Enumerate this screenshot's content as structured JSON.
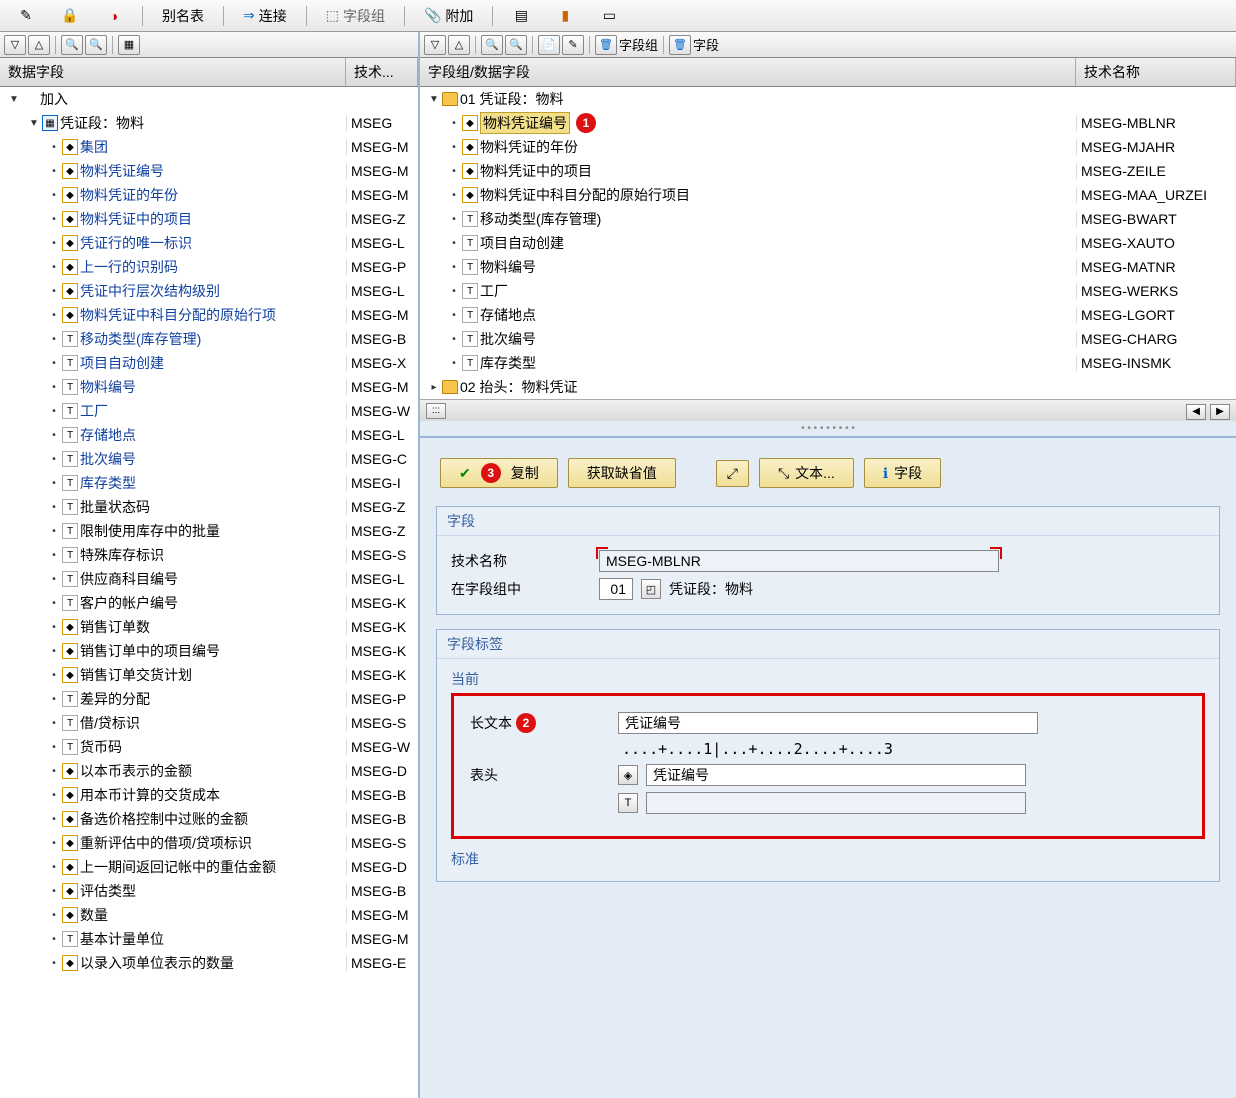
{
  "topbar": {
    "alias_table": "别名表",
    "connect": "连接",
    "field_group": "字段组",
    "attach": "附加"
  },
  "left": {
    "col1": "数据字段",
    "col2": "技术...",
    "rows": [
      {
        "indent": 0,
        "exp": "▼",
        "icon": "",
        "lbl": "加入",
        "tech": "",
        "link": false
      },
      {
        "indent": 1,
        "exp": "▼",
        "icon": "table",
        "lbl": "凭证段：物料",
        "tech": "MSEG",
        "link": false
      },
      {
        "indent": 2,
        "exp": "•",
        "icon": "key",
        "lbl": "集团",
        "tech": "MSEG-M",
        "link": true
      },
      {
        "indent": 2,
        "exp": "•",
        "icon": "key",
        "lbl": "物料凭证编号",
        "tech": "MSEG-M",
        "link": true
      },
      {
        "indent": 2,
        "exp": "•",
        "icon": "key",
        "lbl": "物料凭证的年份",
        "tech": "MSEG-M",
        "link": true
      },
      {
        "indent": 2,
        "exp": "•",
        "icon": "key",
        "lbl": "物料凭证中的项目",
        "tech": "MSEG-Z",
        "link": true
      },
      {
        "indent": 2,
        "exp": "•",
        "icon": "key",
        "lbl": "凭证行的唯一标识",
        "tech": "MSEG-L",
        "link": true
      },
      {
        "indent": 2,
        "exp": "•",
        "icon": "key",
        "lbl": "上一行的识别码",
        "tech": "MSEG-P",
        "link": true
      },
      {
        "indent": 2,
        "exp": "•",
        "icon": "key",
        "lbl": "凭证中行层次结构级别",
        "tech": "MSEG-L",
        "link": true
      },
      {
        "indent": 2,
        "exp": "•",
        "icon": "key",
        "lbl": "物料凭证中科目分配的原始行项",
        "tech": "MSEG-M",
        "link": true
      },
      {
        "indent": 2,
        "exp": "•",
        "icon": "txt",
        "lbl": "移动类型(库存管理)",
        "tech": "MSEG-B",
        "link": true
      },
      {
        "indent": 2,
        "exp": "•",
        "icon": "txt",
        "lbl": "项目自动创建",
        "tech": "MSEG-X",
        "link": true
      },
      {
        "indent": 2,
        "exp": "•",
        "icon": "txt",
        "lbl": "物料编号",
        "tech": "MSEG-M",
        "link": true
      },
      {
        "indent": 2,
        "exp": "•",
        "icon": "txt",
        "lbl": "工厂",
        "tech": "MSEG-W",
        "link": true
      },
      {
        "indent": 2,
        "exp": "•",
        "icon": "txt",
        "lbl": "存储地点",
        "tech": "MSEG-L",
        "link": true
      },
      {
        "indent": 2,
        "exp": "•",
        "icon": "txt",
        "lbl": "批次编号",
        "tech": "MSEG-C",
        "link": true
      },
      {
        "indent": 2,
        "exp": "•",
        "icon": "txt",
        "lbl": "库存类型",
        "tech": "MSEG-I",
        "link": true
      },
      {
        "indent": 2,
        "exp": "•",
        "icon": "txt",
        "lbl": "批量状态码",
        "tech": "MSEG-Z",
        "link": false
      },
      {
        "indent": 2,
        "exp": "•",
        "icon": "txt",
        "lbl": "限制使用库存中的批量",
        "tech": "MSEG-Z",
        "link": false
      },
      {
        "indent": 2,
        "exp": "•",
        "icon": "txt",
        "lbl": "特殊库存标识",
        "tech": "MSEG-S",
        "link": false
      },
      {
        "indent": 2,
        "exp": "•",
        "icon": "txt",
        "lbl": "供应商科目编号",
        "tech": "MSEG-L",
        "link": false
      },
      {
        "indent": 2,
        "exp": "•",
        "icon": "txt",
        "lbl": "客户的帐户编号",
        "tech": "MSEG-K",
        "link": false
      },
      {
        "indent": 2,
        "exp": "•",
        "icon": "key",
        "lbl": "销售订单数",
        "tech": "MSEG-K",
        "link": false
      },
      {
        "indent": 2,
        "exp": "•",
        "icon": "key",
        "lbl": "销售订单中的项目编号",
        "tech": "MSEG-K",
        "link": false
      },
      {
        "indent": 2,
        "exp": "•",
        "icon": "key",
        "lbl": "销售订单交货计划",
        "tech": "MSEG-K",
        "link": false
      },
      {
        "indent": 2,
        "exp": "•",
        "icon": "txt",
        "lbl": "差异的分配",
        "tech": "MSEG-P",
        "link": false
      },
      {
        "indent": 2,
        "exp": "•",
        "icon": "txt",
        "lbl": "借/贷标识",
        "tech": "MSEG-S",
        "link": false
      },
      {
        "indent": 2,
        "exp": "•",
        "icon": "txt",
        "lbl": "货币码",
        "tech": "MSEG-W",
        "link": false
      },
      {
        "indent": 2,
        "exp": "•",
        "icon": "key",
        "lbl": "以本币表示的金额",
        "tech": "MSEG-D",
        "link": false
      },
      {
        "indent": 2,
        "exp": "•",
        "icon": "key",
        "lbl": "用本币计算的交货成本",
        "tech": "MSEG-B",
        "link": false
      },
      {
        "indent": 2,
        "exp": "•",
        "icon": "key",
        "lbl": "备选价格控制中过账的金额",
        "tech": "MSEG-B",
        "link": false
      },
      {
        "indent": 2,
        "exp": "•",
        "icon": "key",
        "lbl": "重新评估中的借项/贷项标识",
        "tech": "MSEG-S",
        "link": false
      },
      {
        "indent": 2,
        "exp": "•",
        "icon": "key",
        "lbl": "上一期间返回记帐中的重估金额",
        "tech": "MSEG-D",
        "link": false
      },
      {
        "indent": 2,
        "exp": "•",
        "icon": "key",
        "lbl": "评估类型",
        "tech": "MSEG-B",
        "link": false
      },
      {
        "indent": 2,
        "exp": "•",
        "icon": "key",
        "lbl": "数量",
        "tech": "MSEG-M",
        "link": false
      },
      {
        "indent": 2,
        "exp": "•",
        "icon": "txt",
        "lbl": "基本计量单位",
        "tech": "MSEG-M",
        "link": false
      },
      {
        "indent": 2,
        "exp": "•",
        "icon": "key",
        "lbl": "以录入项单位表示的数量",
        "tech": "MSEG-E",
        "link": false
      }
    ]
  },
  "right_top": {
    "col1": "字段组/数据字段",
    "col2": "技术名称",
    "mini_label_grp": "字段组",
    "mini_label_fld": "字段",
    "rows": [
      {
        "indent": 0,
        "exp": "▼",
        "icon": "folder",
        "lbl": "01 凭证段：物料",
        "tech": "",
        "hl": false
      },
      {
        "indent": 1,
        "exp": "•",
        "icon": "key",
        "lbl": "物料凭证编号",
        "tech": "MSEG-MBLNR",
        "hl": true,
        "callout": "1"
      },
      {
        "indent": 1,
        "exp": "•",
        "icon": "key",
        "lbl": "物料凭证的年份",
        "tech": "MSEG-MJAHR",
        "hl": false
      },
      {
        "indent": 1,
        "exp": "•",
        "icon": "key",
        "lbl": "物料凭证中的项目",
        "tech": "MSEG-ZEILE",
        "hl": false
      },
      {
        "indent": 1,
        "exp": "•",
        "icon": "key",
        "lbl": "物料凭证中科目分配的原始行项目",
        "tech": "MSEG-MAA_URZEI",
        "hl": false
      },
      {
        "indent": 1,
        "exp": "•",
        "icon": "txt",
        "lbl": "移动类型(库存管理)",
        "tech": "MSEG-BWART",
        "hl": false
      },
      {
        "indent": 1,
        "exp": "•",
        "icon": "txt",
        "lbl": "项目自动创建",
        "tech": "MSEG-XAUTO",
        "hl": false
      },
      {
        "indent": 1,
        "exp": "•",
        "icon": "txt",
        "lbl": "物料编号",
        "tech": "MSEG-MATNR",
        "hl": false
      },
      {
        "indent": 1,
        "exp": "•",
        "icon": "txt",
        "lbl": "工厂",
        "tech": "MSEG-WERKS",
        "hl": false
      },
      {
        "indent": 1,
        "exp": "•",
        "icon": "txt",
        "lbl": "存储地点",
        "tech": "MSEG-LGORT",
        "hl": false
      },
      {
        "indent": 1,
        "exp": "•",
        "icon": "txt",
        "lbl": "批次编号",
        "tech": "MSEG-CHARG",
        "hl": false
      },
      {
        "indent": 1,
        "exp": "•",
        "icon": "txt",
        "lbl": "库存类型",
        "tech": "MSEG-INSMK",
        "hl": false
      },
      {
        "indent": 0,
        "exp": "▸",
        "icon": "folder",
        "lbl": "02 抬头：物料凭证",
        "tech": "",
        "hl": false
      }
    ]
  },
  "buttons": {
    "copy": "复制",
    "get_default": "获取缺省值",
    "text": "文本...",
    "field": "字段",
    "callout3": "3"
  },
  "field_section": {
    "legend": "字段",
    "tech_name_label": "技术名称",
    "tech_name_value": "MSEG-MBLNR",
    "in_group_label": "在字段组中",
    "in_group_num": "01",
    "in_group_text": "凭证段：物料"
  },
  "label_section": {
    "legend": "字段标签",
    "current": "当前",
    "callout2": "2",
    "long_text_label": "长文本",
    "long_text_value": "凭证编号",
    "ruler": "....+....1|...+....2....+....3",
    "header_label": "表头",
    "header_value": "凭证编号",
    "standard": "标准"
  }
}
